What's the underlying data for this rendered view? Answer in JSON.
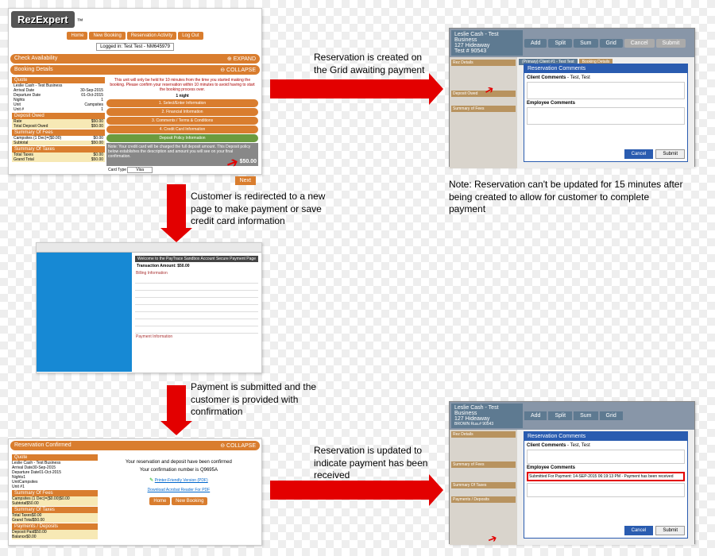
{
  "brand": "RezExpert",
  "nav": {
    "home": "Home",
    "new": "New Booking",
    "activity": "Reservation Activity",
    "logout": "Log Out"
  },
  "logged_in": "Logged in: Test Test - NM645979",
  "panelA": {
    "check_avail": "Check Availability",
    "expand": "⊕ EXPAND",
    "collapse": "⊖ COLLAPSE",
    "booking_details": "Booking Details",
    "quote": "Quote",
    "biz": "Leslie Cash - Test Business",
    "arrival_l": "Arrival Date",
    "arrival_v": "30-Sep-2015",
    "depart_l": "Departure Date",
    "depart_v": "01-Oct-2015",
    "nights_l": "Nights",
    "nights_v": "1",
    "unit_l": "Unit",
    "unit_v": "Campsites",
    "unit2_l": "Unit #",
    "unit2_v": "1",
    "deposit_owed": "Deposit Owed",
    "rate_l": "Rate",
    "rate_v": "$50.00",
    "tdo_l": "Total Deposit Owed",
    "tdo_v": "$50.00",
    "summary_fees": "Summary Of Fees",
    "camp_l": "Campsites (1 Dec)=($0.00)",
    "camp_v": "$0.00",
    "sub_l": "Subtotal",
    "sub_v": "$50.00",
    "summary_taxes": "Summary Of Taxes",
    "tt_l": "Total Taxes",
    "tt_v": "$0.00",
    "gt_l": "Grand Total",
    "gt_v": "$50.00",
    "notice": "This unit will only be held for 10 minutes from the time you started making the booking. Please confirm your reservation within 10 minutes to avoid having to start the booking process over.",
    "nights_txt": "1 night",
    "s1": "1. Select/Enter Information",
    "s2": "2. Financial Information",
    "s3": "3. Comments / Terms & Conditions",
    "s4": "4. Credit Card Information",
    "s5": "Deposit Policy Information",
    "note": "Note: Your credit card will be charged the full deposit amount. This Deposit policy below establishes the description and amount you will see on your final confirmation.",
    "total": "$50.00",
    "card_l": "Card Type",
    "card_v": "Visa",
    "next": "Next"
  },
  "panelB": {
    "biz1": "Leslie Cash - Test Business",
    "biz2": "127 Hideaway",
    "biz3": "Test   # 90543",
    "add": "Add",
    "split": "Split",
    "sum": "Sum",
    "grid": "Grid",
    "cancel": "Cancel",
    "submit": "Submit",
    "rez": "Rez Details",
    "client": "(Primary) Client #1 - Test Test",
    "booking": "Booking Details",
    "modal_title": "Reservation Comments",
    "cc_l": "Client Comments",
    "cc_v": "- Test, Test",
    "ec_l": "Employee Comments",
    "ec_v": "",
    "m_cancel": "Cancel",
    "m_submit": "Submit",
    "deposit": "Deposit Owed",
    "sumfees": "Summary of Fees"
  },
  "panelC": {
    "title": "Welcome to the PayTrace Sandbox Account Secure Payment Page",
    "amount_l": "Transaction Amount:",
    "amount_v": "$50.00",
    "billing": "Billing Information",
    "payment": "Payment Information"
  },
  "panelD": {
    "hdr": "Reservation Confirmed",
    "msg": "Your reservation and deposit have been confirmed",
    "conf": "Your confirmation number is Q9695A",
    "pdf": "Printer-Friendly Version (PDF)",
    "dl": "Download Acrobat Reader For PDF",
    "pay_dep": "Payments / Deposits",
    "dp_l": "Deposit Paid",
    "dp_v": "$50.00",
    "bal_l": "Balance",
    "bal_v": "$0.00"
  },
  "panelE": {
    "ec_v": "Submitted For Payment: 14-SEP-2015 06:19:13 PM - Payment has been received",
    "payments": "Payments / Deposits"
  },
  "annot": {
    "a1": "Reservation is created on the Grid awaiting payment",
    "a2": "Note:  Reservation can't be updated for 15 minutes after being created to allow for customer to complete payment",
    "a3": "Customer is redirected to a new page to make payment or save credit card information",
    "a4": "Payment is submitted and the customer is provided with confirmation",
    "a5": "Reservation is updated to indicate payment has been received"
  }
}
